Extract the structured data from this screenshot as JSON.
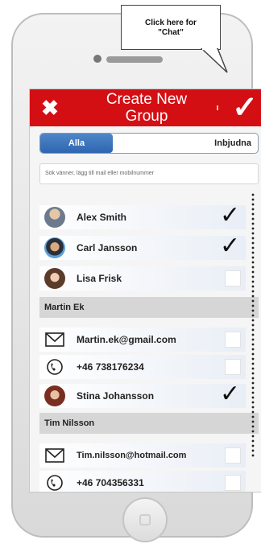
{
  "callout": {
    "line1": "Click here for",
    "line2": "\"Chat\""
  },
  "header": {
    "close_icon": "x-icon",
    "title_line1": "Create New",
    "title_line2": "Group",
    "confirm_icon": "checkmark-icon"
  },
  "tabs": {
    "active": "Alla",
    "inactive": "Inbjudna"
  },
  "search": {
    "placeholder": "Sök vänner, lägg till mail eller mobilnummer"
  },
  "contacts": [
    {
      "name": "Alex Smith",
      "selected": true
    },
    {
      "name": "Carl Jansson",
      "selected": true
    },
    {
      "name": "Lisa Frisk",
      "selected": false
    }
  ],
  "martin": {
    "header": "Martin Ek",
    "email": "Martin.ek@gmail.com",
    "phone": "+46 738176234"
  },
  "stina": {
    "name": "Stina Johansson",
    "selected": true
  },
  "tim": {
    "header": "Tim Nilsson",
    "email": "Tim.nilsson@hotmail.com",
    "phone": "+46 704356331"
  },
  "colors": {
    "header_bg": "#d40f14",
    "tab_active": "#2f66b0",
    "group_header_bg": "#d6d6d6"
  }
}
